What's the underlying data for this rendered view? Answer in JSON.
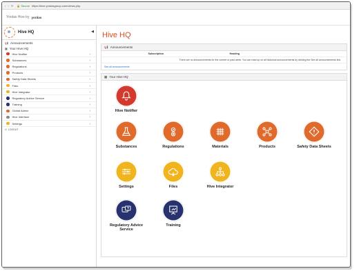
{
  "browser": {
    "secure_label": "Secure",
    "url": "https://hive.yordasgroup.com/views.php"
  },
  "topbar": {
    "brand": "Yordas Hive by",
    "brand2": "yordas"
  },
  "sidebar": {
    "title": "Hive HQ",
    "announcements": "Announcements",
    "section": "Your Hive HQ",
    "items": [
      {
        "label": "Hive Notifier",
        "color": "#d33a2d"
      },
      {
        "label": "Substances",
        "color": "#e06a2b"
      },
      {
        "label": "Regulations",
        "color": "#e06a2b"
      },
      {
        "label": "Products",
        "color": "#e06a2b"
      },
      {
        "label": "Safety Data Sheets",
        "color": "#e06a2b"
      },
      {
        "label": "Files",
        "color": "#f0b41e"
      },
      {
        "label": "Hive Integrator",
        "color": "#f0b41e"
      },
      {
        "label": "Regulatory Advice Service",
        "color": "#27326f"
      },
      {
        "label": "Training",
        "color": "#27326f"
      },
      {
        "label": "Global Admin",
        "color": "#e06a2b"
      },
      {
        "label": "Hive Interface",
        "color": "#888888"
      },
      {
        "label": "Settings",
        "color": "#f0b41e"
      }
    ],
    "logout": "LOGOUT"
  },
  "main": {
    "title": "Hive HQ",
    "announcements": {
      "heading": "Announcements",
      "col_subscription": "Subscription",
      "col_heading": "Heading",
      "row_text": "There are no announcements for the current or past week. You can read up on all historical announcements by clicking the See all announcements link.",
      "see_all": "See all announcements"
    },
    "your_hive": {
      "heading": "Your Hive HQ",
      "tiles": [
        {
          "label": "Hive Notifier",
          "icon": "bell-icon",
          "color": "#d33a2d"
        },
        {
          "label": "Substances",
          "icon": "flask-icon",
          "color": "#e06a2b"
        },
        {
          "label": "Regulations",
          "icon": "checklist-icon",
          "color": "#e06a2b"
        },
        {
          "label": "Materials",
          "icon": "grid-icon",
          "color": "#e06a2b"
        },
        {
          "label": "Products",
          "icon": "network-icon",
          "color": "#e06a2b"
        },
        {
          "label": "Safety Data Sheets",
          "icon": "warning-icon",
          "color": "#e06a2b"
        },
        {
          "label": "Settings",
          "icon": "sliders-icon",
          "color": "#f0b41e"
        },
        {
          "label": "Files",
          "icon": "cloud-icon",
          "color": "#f0b41e"
        },
        {
          "label": "Hive Integrator",
          "icon": "hierarchy-icon",
          "color": "#f0b41e"
        },
        {
          "label": "Regulatory Advice Service",
          "icon": "chat-icon",
          "color": "#27326f"
        },
        {
          "label": "Training",
          "icon": "presentation-icon",
          "color": "#27326f"
        }
      ]
    }
  }
}
